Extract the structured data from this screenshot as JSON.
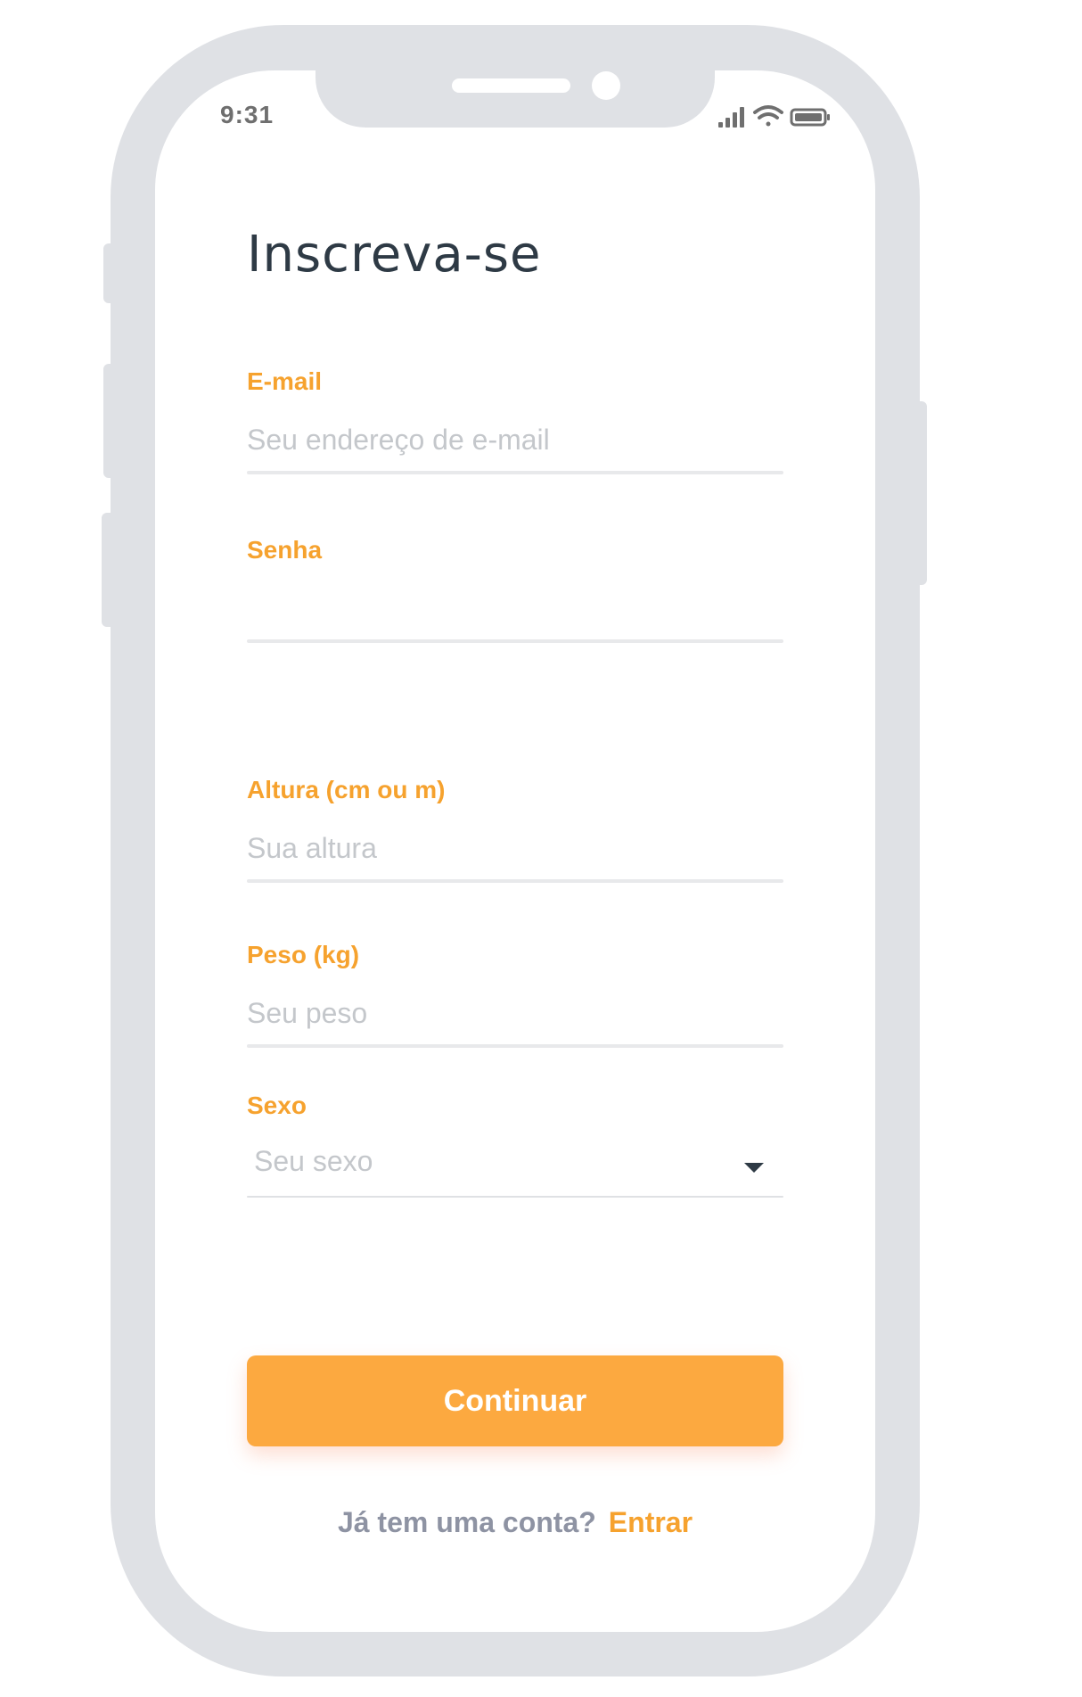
{
  "status_bar": {
    "time": "9:31",
    "icons": [
      "signal-icon",
      "wifi-icon",
      "battery-icon"
    ]
  },
  "page": {
    "title": "Inscreva-se"
  },
  "form": {
    "email": {
      "label": "E-mail",
      "placeholder": "Seu endereço de e-mail",
      "value": ""
    },
    "password": {
      "label": "Senha",
      "placeholder": "",
      "value": ""
    },
    "height": {
      "label": "Altura (cm ou m)",
      "placeholder": "Sua altura",
      "value": ""
    },
    "weight": {
      "label": "Peso (kg)",
      "placeholder": "Seu peso",
      "value": ""
    },
    "sex": {
      "label": "Sexo",
      "selected": "Seu sexo"
    }
  },
  "actions": {
    "continue_label": "Continuar"
  },
  "footer": {
    "prompt": "Já tem uma conta?",
    "link": "Entrar"
  },
  "colors": {
    "accent": "#f6a22e",
    "button": "#fca940",
    "title": "#2e3a45",
    "frame": "#dfe1e5",
    "placeholder": "#c4c7cb",
    "muted": "#8e93a3"
  }
}
